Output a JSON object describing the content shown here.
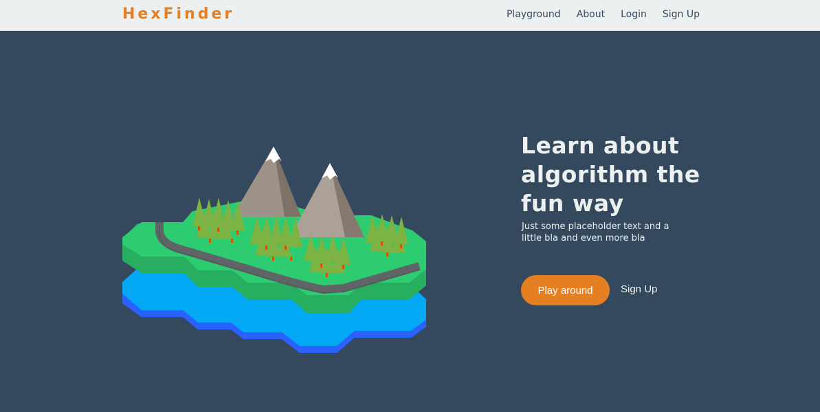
{
  "brand": {
    "name": "HexFinder",
    "color": "#e67e22"
  },
  "nav": {
    "items": [
      {
        "label": "Playground"
      },
      {
        "label": "About"
      },
      {
        "label": "Login"
      },
      {
        "label": "Sign Up"
      }
    ]
  },
  "hero": {
    "headline": "Learn about algorithm the fun way",
    "subtext": "Just some placeholder text and a little bla and even more bla",
    "primary_button": "Play around",
    "secondary_link": "Sign Up",
    "background": "#34495e",
    "accent": "#e67e22"
  },
  "illustration": {
    "subject": "isometric hexagon island with mountains, trees, road and water",
    "colors": {
      "grass": "#2ecc71",
      "water": "#03a9f4",
      "mountain": "#9e9389",
      "road": "#5f6566",
      "tree": "#8bc34a"
    }
  }
}
